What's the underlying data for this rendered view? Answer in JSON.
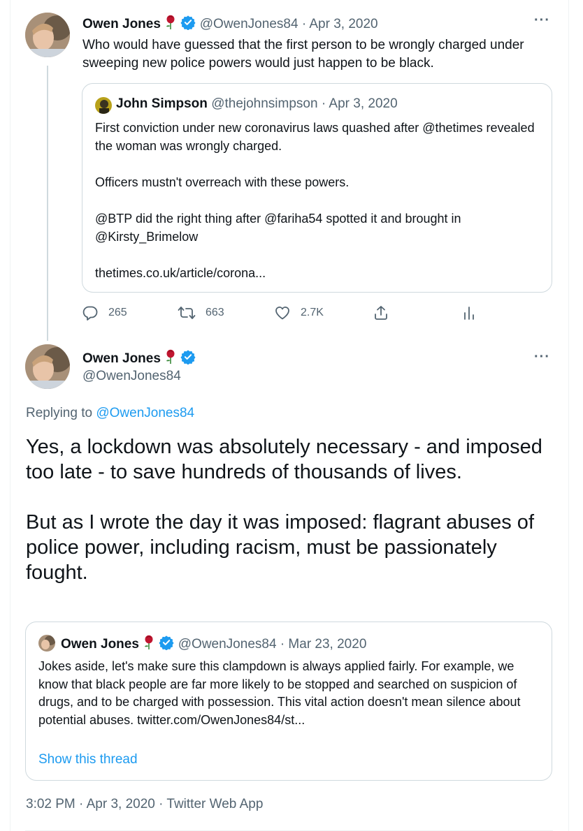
{
  "tweet1": {
    "author_name": "Owen Jones",
    "handle": "@OwenJones84",
    "date": "Apr 3, 2020",
    "text": "Who would have guessed that the first person to be wrongly charged under sweeping new police powers would just happen to be black.",
    "quoted": {
      "author_name": "John Simpson",
      "handle": "@thejohnsimpson",
      "date": "Apr 3, 2020",
      "paragraphs": [
        "First conviction under new coronavirus laws quashed after @thetimes revealed the woman was wrongly charged.",
        "Officers mustn't overreach with these powers.",
        "@BTP did the right thing after @fariha54 spotted it and brought in @Kirsty_Brimelow",
        "thetimes.co.uk/article/corona..."
      ]
    },
    "replies": "265",
    "retweets": "663",
    "likes": "2.7K"
  },
  "tweet2": {
    "author_name": "Owen Jones",
    "handle": "@OwenJones84",
    "replying_prefix": "Replying to",
    "replying_to": "@OwenJones84",
    "paragraphs": [
      "Yes, a lockdown was absolutely necessary - and imposed too late - to save hundreds of thousands of lives.",
      "But as I wrote the day it was imposed: flagrant abuses of police power, including racism, must be passionately fought."
    ],
    "quoted": {
      "author_name": "Owen Jones",
      "handle": "@OwenJones84",
      "date": "Mar 23, 2020",
      "text": "Jokes aside, let's make sure this clampdown is always applied fairly. For example, we know that black people are far more likely to be stopped and searched on suspicion of drugs, and to be charged with possession. This vital action doesn't mean silence about potential abuses. twitter.com/OwenJones84/st...",
      "show_thread": "Show this thread"
    },
    "time": "3:02 PM",
    "date": "Apr 3, 2020",
    "source": "Twitter Web App"
  },
  "separator": "·",
  "icons": {
    "more": "more-dots-icon",
    "rose": "rose-emoji-icon",
    "verified": "verified-badge-icon",
    "reply": "reply-icon",
    "retweet": "retweet-icon",
    "like": "heart-icon",
    "share": "share-icon",
    "analytics": "analytics-icon"
  },
  "colors": {
    "text": "#0f1419",
    "muted": "#536471",
    "link": "#1d9bf0",
    "border": "#cfd9de"
  }
}
